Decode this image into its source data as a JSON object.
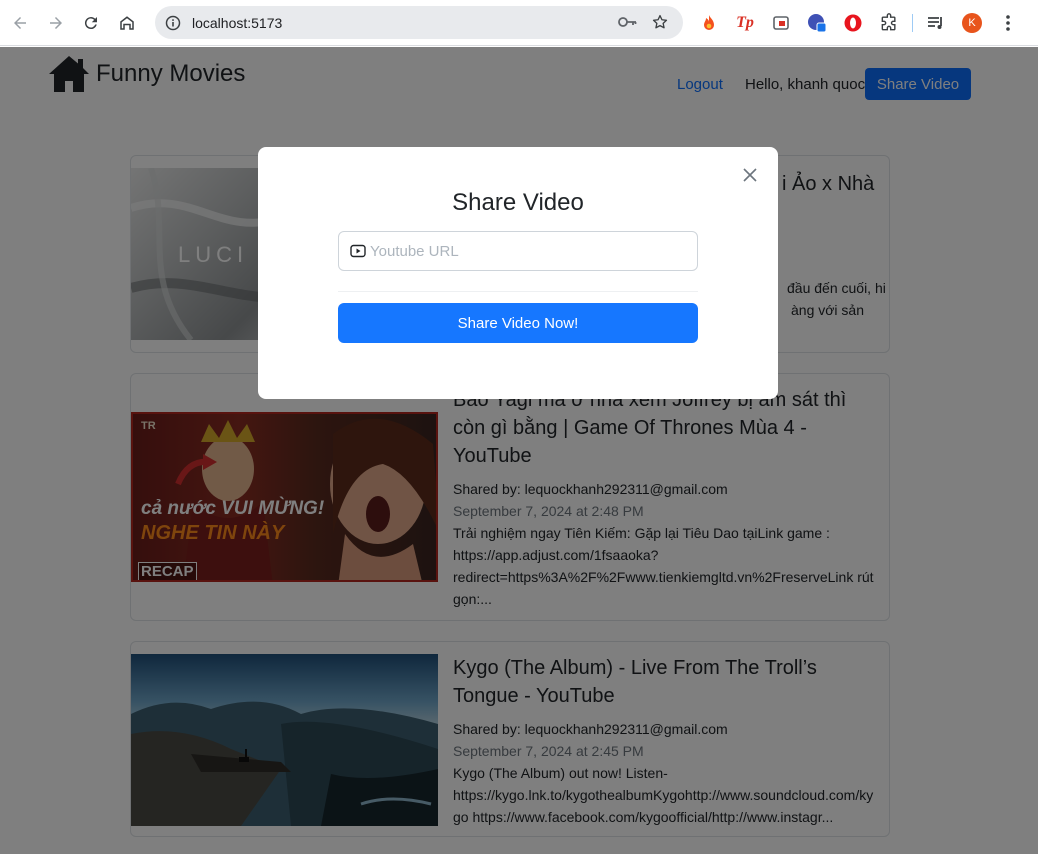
{
  "browser": {
    "url": "localhost:5173",
    "profile_initial": "K",
    "extensions": [
      "tp-extension"
    ]
  },
  "header": {
    "brand": "Funny Movies",
    "logout": "Logout",
    "greeting": "Hello, khanh quoc",
    "share_button": "Share Video"
  },
  "videos": [
    {
      "title_visible": "i Ảo x Nhà",
      "desc_line1": "đầu đến cuối, hi",
      "desc_line2": "àng với sản",
      "thumb_text": "LUCI"
    },
    {
      "title": "Bao Yagi mà ở nhà xem Joffrey bị ám sát thì còn gì bằng | Game Of Thrones Mùa 4 - YouTube",
      "shared_by": "Shared by: lequockhanh292311@gmail.com",
      "date": "September 7, 2024 at 2:48 PM",
      "description": "Trải nghiệm ngay Tiên Kiếm: Gặp lại Tiêu Dao tạiLink game : https://app.adjust.com/1fsaaoka?redirect=https%3A%2F%2Fwww.tienkiemgltd.vn%2FreserveLink rút gọn:...",
      "thumb_line1": "cả nước VUI MỪNG!",
      "thumb_line2": "NGHE TIN NÀY",
      "thumb_badge": "RECAP",
      "thumb_corner": "TR"
    },
    {
      "title": "Kygo (The Album) - Live From The Troll’s Tongue - YouTube",
      "shared_by": "Shared by: lequockhanh292311@gmail.com",
      "date": "September 7, 2024 at 2:45 PM",
      "description": "Kygo (The Album) out now! Listen- https://kygo.lnk.to/kygothealbumKygohttp://www.soundcloud.com/kygo https://www.facebook.com/kygoofficial/http://www.instagr..."
    }
  ],
  "modal": {
    "title": "Share Video",
    "url_placeholder": "Youtube URL",
    "submit": "Share Video Now!"
  },
  "colors": {
    "primary": "#0d6efd",
    "modal_button": "#1677ff",
    "backdrop": "rgba(0,0,0,0.5)"
  }
}
